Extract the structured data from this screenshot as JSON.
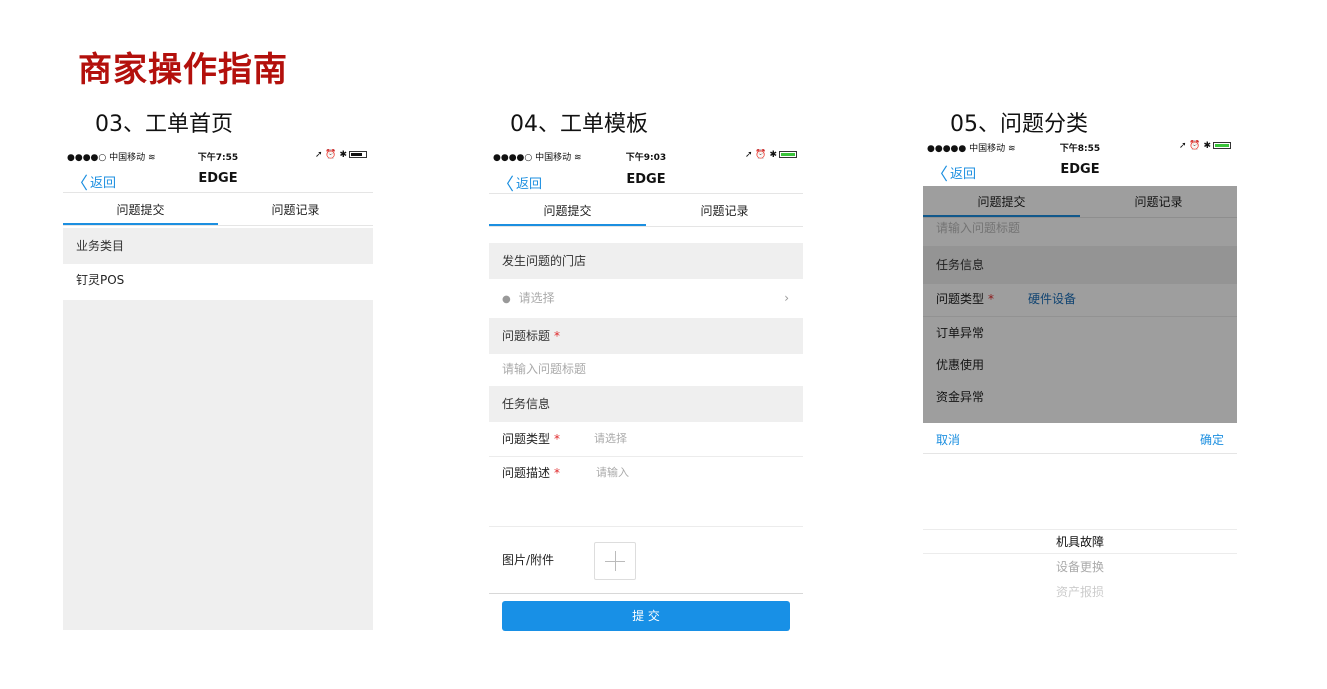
{
  "page_title": "商家操作指南",
  "steps": {
    "s03": "03、工单首页",
    "s04": "04、工单模板",
    "s05": "05、问题分类"
  },
  "colors": {
    "brand_red": "#b3100c",
    "accent_blue": "#1c8fe0",
    "required_red": "#e0292b",
    "submit_blue": "#1890e6"
  },
  "phone1": {
    "status": {
      "carrier": "●●●●○ 中国移动 ≋",
      "time": "下午7:55",
      "icons": "➚ ⏰ ✱"
    },
    "nav": {
      "back": "返回",
      "title": "EDGE"
    },
    "tabs": [
      "问题提交",
      "问题记录"
    ],
    "section_header": "业务类目",
    "item": "钉灵POS"
  },
  "phone2": {
    "status": {
      "carrier": "●●●●○ 中国移动 ≋",
      "time": "下午9:03",
      "icons": "➚ ⏰ ✱"
    },
    "nav": {
      "back": "返回",
      "title": "EDGE"
    },
    "tabs": [
      "问题提交",
      "问题记录"
    ],
    "store_header": "发生问题的门店",
    "store_placeholder": "请选择",
    "title_header": "问题标题",
    "title_placeholder": "请输入问题标题",
    "task_header": "任务信息",
    "type_label": "问题类型",
    "type_placeholder": "请选择",
    "desc_label": "问题描述",
    "desc_placeholder": "请输入",
    "attach_label": "图片/附件",
    "submit": "提 交",
    "required": "*"
  },
  "phone3": {
    "status": {
      "carrier": "●●●●● 中国移动 ≋",
      "time": "下午8:55",
      "icons": "➚ ⏰ ✱"
    },
    "nav": {
      "back": "返回",
      "title": "EDGE"
    },
    "tabs": [
      "问题提交",
      "问题记录"
    ],
    "faded_placeholder": "请输入问题标题",
    "task_header": "任务信息",
    "type_label": "问题类型",
    "type_value": "硬件设备",
    "required": "*",
    "options": [
      "订单异常",
      "优惠使用",
      "资金异常"
    ],
    "cancel": "取消",
    "confirm": "确定",
    "picker": [
      "机具故障",
      "设备更换",
      "资产报损"
    ]
  }
}
